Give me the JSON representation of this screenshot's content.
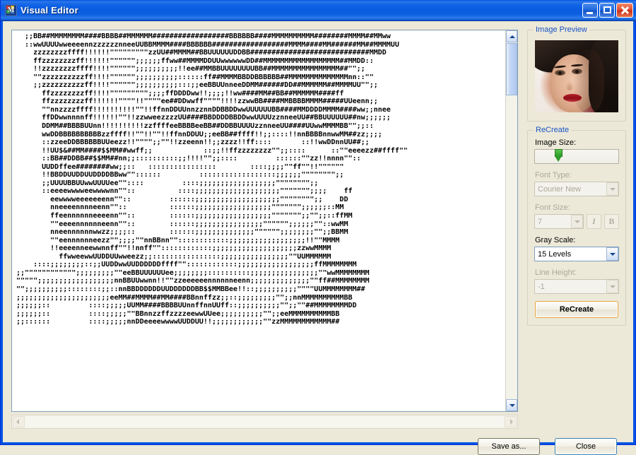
{
  "window": {
    "title": "Visual Editor",
    "icon": "app-icon",
    "controls": {
      "minimize": "minimize-button",
      "maximize": "maximize-button",
      "close": "close-button"
    }
  },
  "editor": {
    "ascii_art": "  ;;BB##MMMMMMMM####BBBB##MMMMMM##################BBBBBB####MMMMMMMMMM########MMMM##MMww\n  ::wwUUUUwweeeennzzzzzznneeUUBBMMMM####BBBBBB##################MMMM####MM######MM##MMMMUU\n    zzzzzzzzffff!!!!!!\"\"\"\"\"\"\"\"\"zzUU##MMMM##BBUUUUUUDDBB############################MMDD\n    ffzzzzzzzzff!!!!!!\"\"\"\"\"\";;;;;;ffww##MMMMDDUUwwwwwwDD##MMMMMMMMMMMMMMMMMM##MMDD::\n    !!zzzzzzzzffff!!!!\"\"\"\"\"\";;;;;;;;;;!!ee##MMBBUUUUUUUUBB##MMMMMMMMMMMMMMMM##\"\";;\n    \"\"zzzzzzzzzzff!!!!\"\"\"\"\"\";;;;;;;;;;::::::ff##MMMMBBDDBBBBBB##MMMMMMMMMMMMMMnn::\"\"\n    ;;zzzzzzzzzzff!!!!\"\"\"\"\"\";;;;;;;;;;:::;;eeBBUUnneeDDMM######DD##MMMMMM##MMMMUU\"\";;\n      ffzzzzzzzzff!!!!\"\"\"\"\"\"\"\"\";;;;ffDDDDww!!;;;;!!ww####MM##BB##MMMMMM####ff\n      ffzzzzzzzzff!!!!!!\"\"\"\"!!\"\"\"\"ee##DDwwff\"\"\"\"!!!!zzwwBB####MMBBBBMMMM#####UUeenn;;\n      \"\"nnzzzzffff!!!!!!!!!!\"\"!!ffnnDDUUnnzznnDDBBDDwwUUUUUUBB####MMDDDDMMMM####ww;;nnee\n      ffDDwwnnnnff!!!!!!\"\"!!zzwweezzzzUU####BBDDDDBBDDwwUUUUzznneeUU##BBUUUUUU##nw;;;;;;\n      DDMM##BBBBUUnn!!!!!!!!!!zzffffeeBBBBeeBB##DDBBUUUUzznneeUU####UUwwMMMMBB\"\";;::\n      wwDDBBBBBBBBBBzzffff!!\"\"!!\"\"!!ffnnDDUU;;eeBB##ffff!!;;::::!!nnBBBBnnwwMM##zz;;;;\n      ::zzeeDDBBBBBBUUeezz!!\"\"\"\";;\"\"!!zzeenn!!;;zzzz!!ff::::       ::!!wwDDnnUU##;;\n      !!UU$&##MM####$$MM##wwff;;            ::;;!!ffzzzzzzzz\"\";;::::      ::\"\"eeeezz##ffff\"\"\n      ::BB##DDBB##$$MM##nn;;::::::::::;;!!!!\"\";;::::         ::::::\"\"zz!!nnnn\"\"::\n      UUDDffee########ww;;::   ::::::::::::::::        ::::;;;;\"\"ff\"\"!!\"\"\"\"\"\"\n      !!BBDDUUDDUUDDDDBBww\"\"::::::         ::::::::::::::::::;;;;;;\"\"\"\"\"\"\"\";;\n      ;;UUUUBBUUwwUUUUee\"\"::::         ::::;;;;;;;;;;;;;;;;;;\"\"\"\"\"\"\"\";;\n      ::eeeewwwweewwwwnn\"\"::          ::::;;;;;;;;;;;;;;;;;;;;\"\"\"\"\"\"\";;;;    ff\n        eewwwweeeeeeenn\"\"::         ::::::;;;;;;;;;;;;;;;;;;;;\"\"\"\"\"\"\"\";;    DD\n        nneeeennnneenn\"\"::          ::::::;;;;;;;;;;;;;;;;;;\"\"\"\"\"\"\";;;;;;::MM\n        ffeennnnnneeeenn\"\"::        ::::::;;;;;;;;;;;;;;;;;;\"\"\"\"\"\"\";;\"\";;::ffMM\n        \"\"eeeennnnnneenn\"\"::        ::::::;;;;;;;;;;;;;;;;\"\"\"\"\"\";;;;;;\"\"::wwMM\n        nneennnnnnwwzz;;;;::        ::::::;;;;;;;;;;;;;;\"\"\"\"\"\";;;;;;;;\"\";;BBMM\n        \"\"eennnnnneezz\"\";;;;\"\"nnBBnn\"\"::::::::::::;;;;;;;;;;;;;;;;;;!!\"\"MMMM\n        !!eeeenneewwnnff\"\"!!nnff\"\"::::::::::::;;;;;;;;;;;;;;;;;;;;zzwwMMMM\n          ffwweewwUUDDUUwweezz;;::::::::::::::::;;;;;;;;;;;;;;;;\"\"UUMMMMMM\n    ::::;;;;;;;;::;;UUDDwwUUDDDDDDffff\"\"::::::::::::;;;;;;;;;;;;;;;;;;ffMMMMMMMM\n;;\"\"\"\"\"\"\"\"\"\"\"\";;;;;;;;;\"\"eeBBUUUUUUee;;;;;;;;::::::::::;;;;;;;;;;;;;;;;\"\"wwMMMMMMMM\n\"\"\"\"\";;;;;;;;;;;;;;;;;;nnBBUUwwnn!!\"\"zzeeeeeennnnnneenn;;;;;;;;;;;;;;\"\"ff##MMMMMMMM\n\"\";;;;;;;;;;::::::::;;::nnBBDDDDDDUUDDDDDDBB$$MMBBee!!::;;;;;;;;;;\"\"\"\"UUMMMMMMMM##\n;;;;;;;;;;;;;;;;;;;;;;eeMM##MMMM##MM####BBnnffzz;;::;;;;;;;;;\"\";;nnMMMMMMMMMMBB\n;;;;;;::         ::::;;;;;UUMM####BBBBUUnnffnnUUff::;;;;;;;;;;\"\";;\"\"##MMMMMMMMDD\n;;;;;;::         ::::;;;;;\"\"BBnnzzffzzzzeewwUUee;;;;;;;;;;\"\";;eeMMMMMMMMMMBB\n;;::::::         ::::;;;;;nnDDeeeewwwwUUDDUU!!;;;;;;;;;;;;\"\"zzMMMMMMMMMMMM##",
    "vertical_scrollbar": "active",
    "horizontal_scrollbar": "disabled"
  },
  "preview": {
    "group_title": "Image Preview",
    "image": "portrait-photo"
  },
  "recreate": {
    "group_title": "ReCreate",
    "image_size": {
      "label": "Image Size:",
      "enabled": true
    },
    "font_type": {
      "label": "Font Type:",
      "value": "Courier New",
      "enabled": false
    },
    "font_size": {
      "label": "Font Size:",
      "value": "7",
      "italic_label": "I",
      "bold_label": "B",
      "enabled": false
    },
    "gray_scale": {
      "label": "Gray Scale:",
      "value": "15 Levels",
      "enabled": true
    },
    "line_height": {
      "label": "Line Height:",
      "value": "-1",
      "enabled": false
    },
    "button_label": "ReCreate"
  },
  "footer": {
    "save_as_label": "Save as...",
    "close_label": "Close"
  },
  "colors": {
    "title_bar": "#0054e3",
    "group_title": "#1a52c4",
    "dialog_face": "#ece9d8",
    "disabled_text": "#aca899",
    "focus_border": "#e8a33d",
    "slider_thumb": "#2f9a2a"
  }
}
